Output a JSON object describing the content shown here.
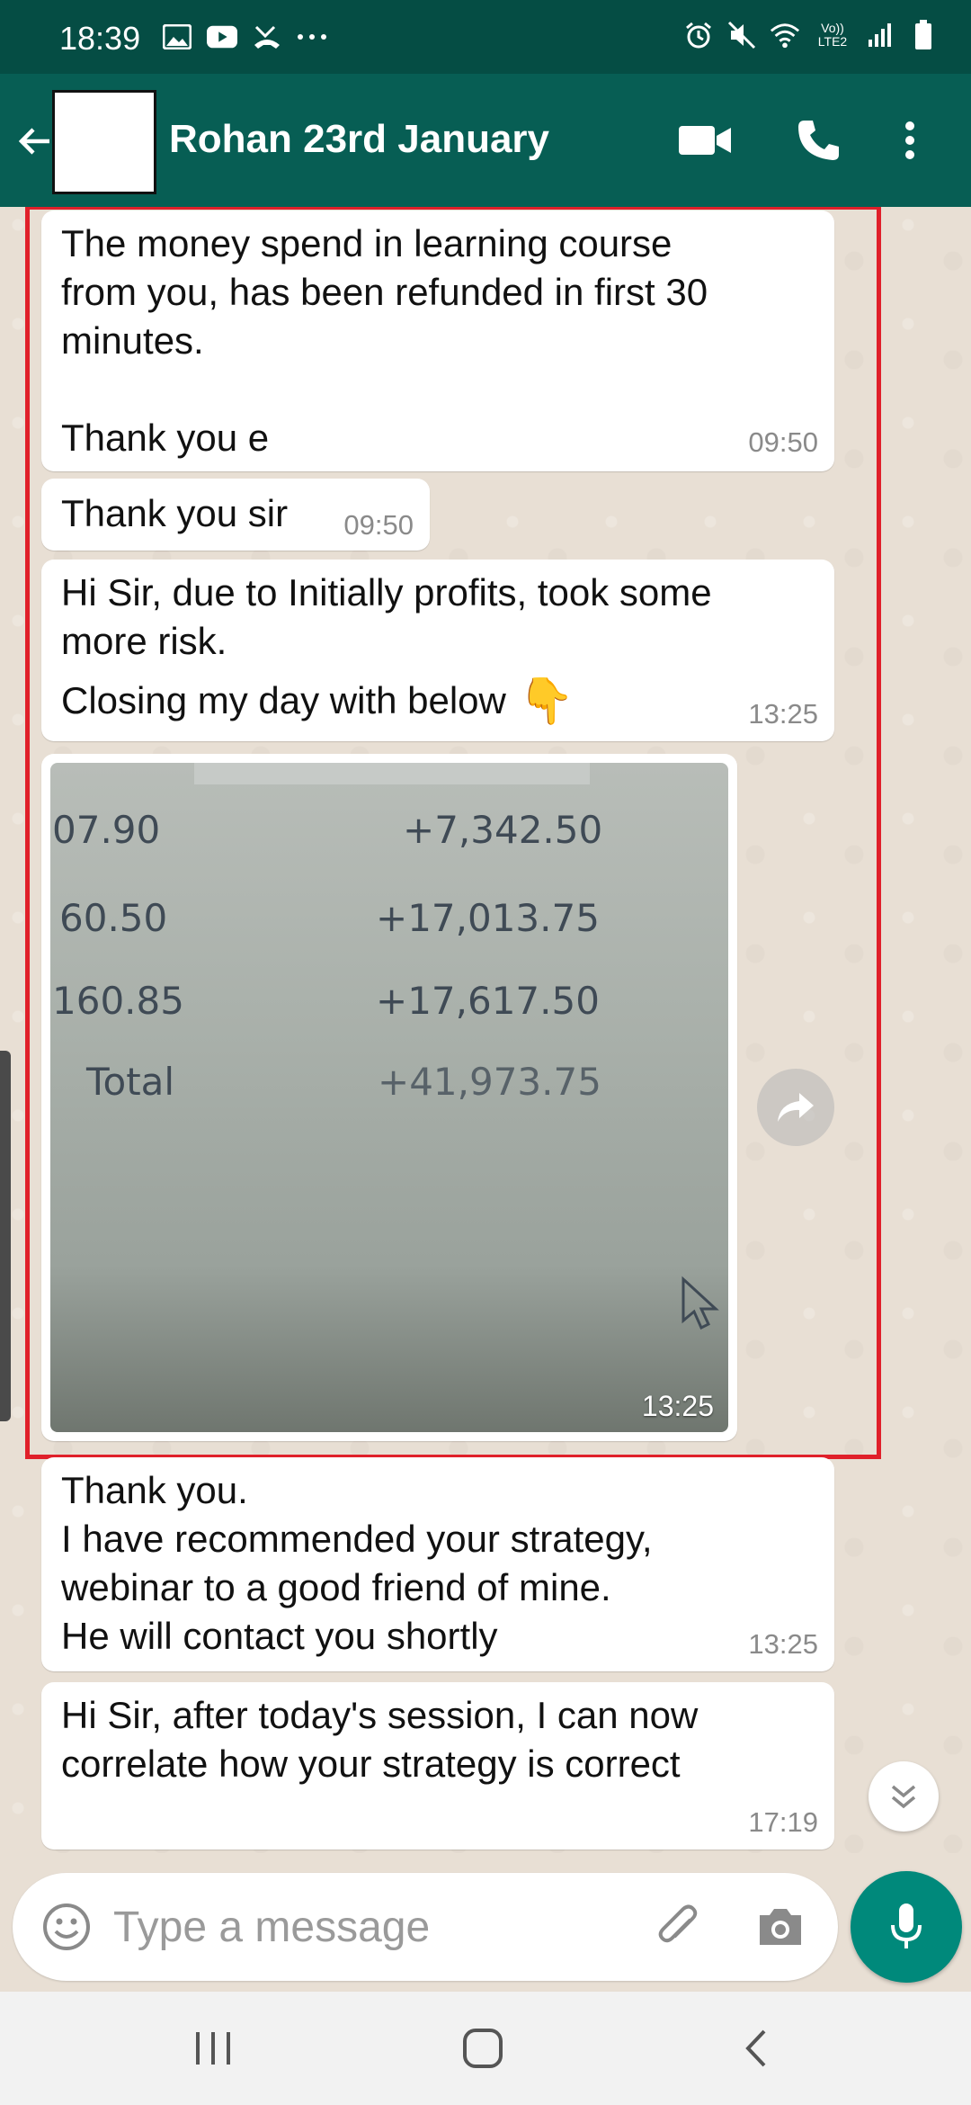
{
  "status_bar": {
    "time": "18:39",
    "left_icons": [
      "image-icon",
      "youtube-icon",
      "missed-call-icon",
      "more-dots-icon"
    ],
    "right_icons": [
      "alarm-icon",
      "mute-icon",
      "wifi-icon",
      "volte-icon",
      "signal-icon",
      "battery-icon"
    ],
    "volte_label": "Vo)) LTE2"
  },
  "header": {
    "contact_name": "Rohan 23rd January",
    "icons": {
      "back": "back-arrow-icon",
      "video": "video-call-icon",
      "call": "phone-icon",
      "menu": "more-vert-icon"
    }
  },
  "messages": [
    {
      "text": "The money spend in learning course\nfrom you, has been refunded in first 30\nminutes.\n\nThank you e",
      "time": "09:50"
    },
    {
      "text": "Thank you sir",
      "time": "09:50"
    },
    {
      "text": "Hi Sir, due to Initially profits, took some\nmore risk.",
      "line3": "Closing my day with below",
      "emoji": "👇",
      "time": "13:25"
    },
    {
      "type": "image",
      "time": "13:25",
      "image_text": [
        {
          "left": "07.90",
          "right": "+7,342.50"
        },
        {
          "left": "60.50",
          "right": "+17,013.75"
        },
        {
          "left": "160.85",
          "right": "+17,617.50"
        },
        {
          "left": "Total",
          "right": "+41,973.75"
        }
      ]
    },
    {
      "text": "Thank you.\nI have recommended your strategy,\nwebinar to a good friend of mine.\nHe will contact you shortly",
      "time": "13:25"
    },
    {
      "text": "Hi Sir, after today's session, I can now\ncorrelate how your strategy is correct",
      "time": "17:19"
    }
  ],
  "input": {
    "placeholder": "Type a message"
  },
  "colors": {
    "header": "#075e54",
    "status_bar": "#054d44",
    "accent": "#00897b",
    "highlight": "#e0202a"
  }
}
